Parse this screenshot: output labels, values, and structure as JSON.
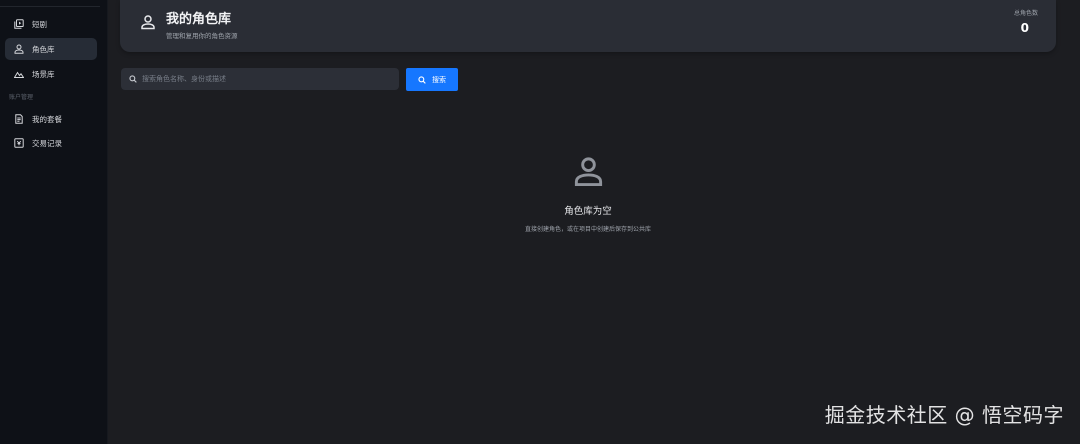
{
  "sidebar": {
    "items": [
      {
        "label": "短剧",
        "icon": "video-library-icon",
        "active": false
      },
      {
        "label": "角色库",
        "icon": "person-icon",
        "active": true
      },
      {
        "label": "场景库",
        "icon": "landscape-icon",
        "active": false
      }
    ],
    "section_label": "账户管理",
    "account_items": [
      {
        "label": "我的套餐",
        "icon": "receipt-icon",
        "active": false
      },
      {
        "label": "交易记录",
        "icon": "transaction-icon",
        "active": false
      }
    ]
  },
  "header": {
    "title": "我的角色库",
    "subtitle": "管理和复用你的角色资源",
    "stat_label": "总角色数",
    "stat_value": "0",
    "icon": "person-icon"
  },
  "search": {
    "placeholder": "搜索角色名称、身份或描述",
    "value": "",
    "button_label": "搜索"
  },
  "empty_state": {
    "icon": "person-icon",
    "title": "角色库为空",
    "description": "直接创建角色，或在项目中创建后保存到公共库"
  },
  "watermark": "掘金技术社区 @ 悟空码字",
  "colors": {
    "accent": "#1677ff",
    "sidebar_bg": "#0e1117",
    "main_bg": "#1c1d21",
    "card_bg": "#2a2d35"
  }
}
